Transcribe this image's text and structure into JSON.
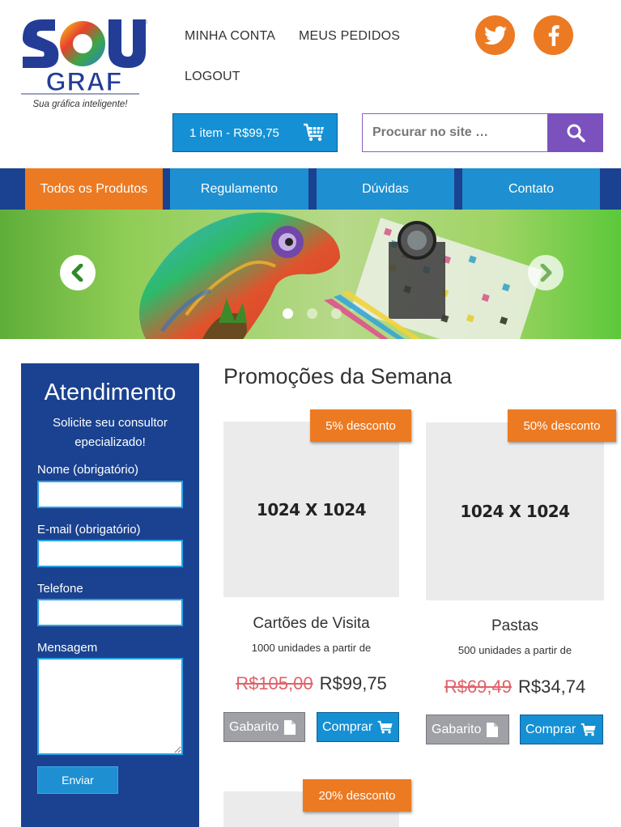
{
  "brand": {
    "logo_top": "SOU",
    "logo_bottom": "GRAF",
    "tagline": "Sua gráfica inteligente!",
    "registered": "®"
  },
  "header": {
    "links": [
      "MINHA CONTA",
      "MEUS PEDIDOS",
      "LOGOUT"
    ],
    "social": [
      "twitter-icon",
      "facebook-icon"
    ],
    "cart_label": "1 item - R$99,75",
    "search_placeholder": "Procurar no site …"
  },
  "nav": {
    "items": [
      "Todos os Produtos",
      "Regulamento",
      "Dúvidas",
      "Contato"
    ],
    "active": "Todos os Produtos"
  },
  "banner": {
    "slides": 3,
    "active_slide": 1
  },
  "sidebar": {
    "title": "Atendimento",
    "subtitle": "Solicite seu consultor epecializado!",
    "fields": {
      "name_label": "Nome (obrigatório)",
      "email_label": "E-mail (obrigatório)",
      "phone_label": "Telefone",
      "message_label": "Mensagem"
    },
    "send_label": "Enviar"
  },
  "promotions": {
    "title": "Promoções da Semana",
    "products": [
      {
        "badge": "5% desconto",
        "image_text": "1024 X 1024",
        "name": "Cartões de Visita",
        "desc": "1000 unidades a partir de",
        "old_price": "R$105,00",
        "price": "R$99,75",
        "gabarito": "Gabarito",
        "buy": "Comprar"
      },
      {
        "badge": "50% desconto",
        "image_text": "1024 X 1024",
        "name": "Pastas",
        "desc": "500 unidades a partir de",
        "old_price": "R$69,49",
        "price": "R$34,74",
        "gabarito": "Gabarito",
        "buy": "Comprar"
      },
      {
        "badge": "20% desconto"
      }
    ]
  },
  "colors": {
    "orange": "#ec7a22",
    "blue": "#1e8fd1",
    "navy": "#1a4290",
    "purple": "#7b52bd"
  }
}
